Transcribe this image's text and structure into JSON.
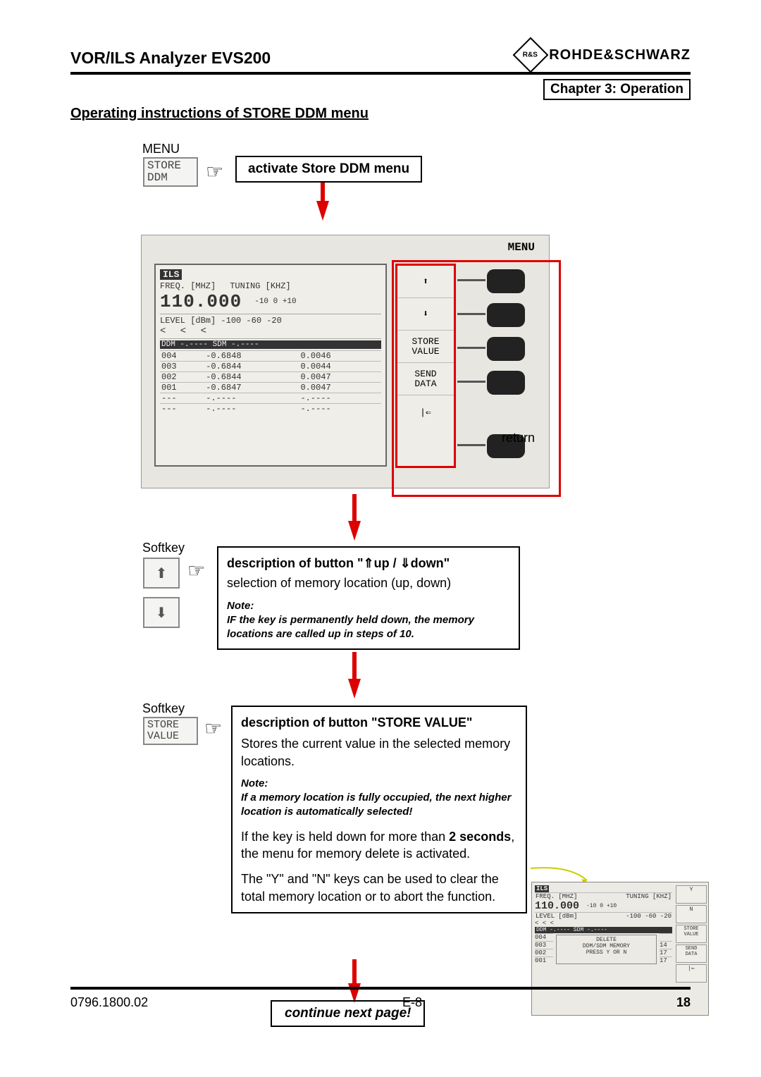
{
  "header": {
    "product": "VOR/ILS Analyzer EVS200",
    "brand": "ROHDE&SCHWARZ",
    "logo_initials": "R&S"
  },
  "chapter": "Chapter 3: Operation",
  "section_title": "Operating instructions of STORE DDM menu",
  "menu_label": "MENU",
  "menu_box": {
    "l1": "STORE",
    "l2": "DDM"
  },
  "activate_box": "activate Store DDM menu",
  "device": {
    "menu_word": "MENU",
    "ils": "ILS",
    "freq_label": "FREQ. [MHZ]",
    "tuning_label": "TUNING [KHZ]",
    "freq_value": "110.000",
    "tuning_scale": "-10   0   +10",
    "level_label": "LEVEL [dBm]",
    "level_scale": "-100   -60   -20",
    "arrows": "< < <",
    "ddm_hdr": "DDM  -.----   SDM  -.----",
    "rows": [
      {
        "n": "004",
        "d": "-0.6848",
        "s": "0.0046"
      },
      {
        "n": "003",
        "d": "-0.6844",
        "s": "0.0044"
      },
      {
        "n": "002",
        "d": "-0.6844",
        "s": "0.0047"
      },
      {
        "n": "001",
        "d": "-0.6847",
        "s": "0.0047"
      },
      {
        "n": "---",
        "d": "-.----",
        "s": "-.----"
      },
      {
        "n": "---",
        "d": "-.----",
        "s": "-.----"
      }
    ],
    "softkeys": {
      "up": "⬆",
      "down": "⬇",
      "store": "STORE\nVALUE",
      "send": "SEND\nDATA",
      "ret": "|⇐"
    },
    "return_label": "return"
  },
  "softkey_label": "Softkey",
  "desc1": {
    "title": "description of button \"⇑up / ⇓down\"",
    "body": "selection of memory location (up, down)",
    "note_label": "Note:",
    "note_body": "IF the key is permanently held down, the memory locations are called up in steps of 10."
  },
  "store_softkey": {
    "l1": "STORE",
    "l2": "VALUE"
  },
  "desc2": {
    "title": "description of button \"STORE VALUE\"",
    "body": "Stores the current value in the selected memory locations.",
    "note_label": "Note:",
    "note_body": "If a memory location is fully occupied, the next higher location is automatically selected!",
    "p2a": "If the key is held down for more than ",
    "p2b": "2 seconds",
    "p2c": ", the menu for memory delete is activated.",
    "p3": "The \"Y\" and \"N\" keys can be used to clear the total memory location or to abort the function."
  },
  "mini": {
    "freq": "110.000",
    "delete_lines": [
      "DELETE",
      "DDM/SDM MEMORY",
      "PRESS Y OR N"
    ],
    "side": [
      "Y",
      "N",
      "STORE\nVALUE",
      "SEND\nDATA",
      "|⇐"
    ],
    "nums": [
      "14",
      "17",
      "17"
    ]
  },
  "continue": "continue next page!",
  "footer": {
    "left": "0796.1800.02",
    "center": "E-8",
    "right": "18"
  }
}
